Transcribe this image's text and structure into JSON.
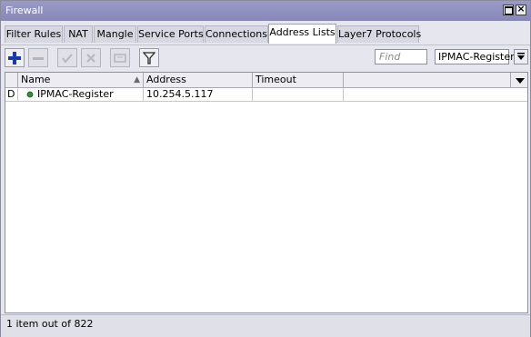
{
  "window": {
    "title": "Firewall"
  },
  "tabs": [
    {
      "label": "Filter Rules"
    },
    {
      "label": "NAT"
    },
    {
      "label": "Mangle"
    },
    {
      "label": "Service Ports"
    },
    {
      "label": "Connections"
    },
    {
      "label": "Address Lists",
      "active": true
    },
    {
      "label": "Layer7 Protocols"
    }
  ],
  "toolbar": {
    "buttons": [
      {
        "icon": "plus-icon",
        "enabled": true
      },
      {
        "icon": "minus-icon",
        "enabled": false
      },
      {
        "icon": "check-icon",
        "enabled": false
      },
      {
        "icon": "cross-icon",
        "enabled": false
      },
      {
        "icon": "comment-icon",
        "enabled": false
      },
      {
        "icon": "filter-icon",
        "enabled": true
      }
    ],
    "find_placeholder": "Find",
    "list_filter_value": "IPMAC-Register"
  },
  "table": {
    "columns": [
      "Name",
      "Address",
      "Timeout"
    ],
    "rows": [
      {
        "flag": "D",
        "name": "IPMAC-Register",
        "address": "10.254.5.117",
        "timeout": ""
      }
    ]
  },
  "status": {
    "text": "1 item out of 822"
  },
  "colors": {
    "titlebar": "#8b8bbb",
    "accent_plus": "#1a3aa8",
    "status_dot": "#3a8a3a"
  }
}
